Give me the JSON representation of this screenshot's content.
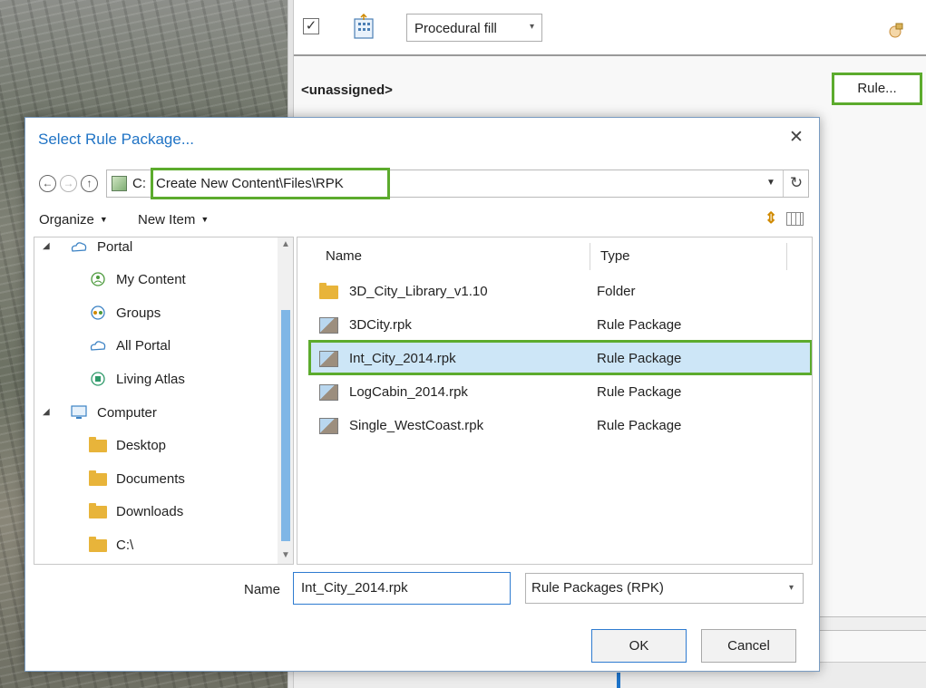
{
  "properties_pane": {
    "visible_checkbox": "✓",
    "fill_type": "Procedural fill",
    "rule_value": "<unassigned>",
    "rule_button": "Rule..."
  },
  "dialog": {
    "title": "Select Rule Package...",
    "close_glyph": "✕",
    "address": {
      "drive": "C:",
      "path": "Create New Content\\Files\\RPK"
    },
    "toolbar": {
      "organize": "Organize",
      "new_item": "New Item"
    },
    "tree": [
      {
        "label": "Portal",
        "icon": "portal-cloud-icon",
        "expander": "expanded"
      },
      {
        "label": "My Content",
        "icon": "my-content-icon"
      },
      {
        "label": "Groups",
        "icon": "groups-icon"
      },
      {
        "label": "All Portal",
        "icon": "cloud-icon"
      },
      {
        "label": "Living Atlas",
        "icon": "living-atlas-icon"
      },
      {
        "label": "Computer",
        "icon": "computer-icon",
        "expander": "expanded"
      },
      {
        "label": "Desktop",
        "icon": "folder-icon"
      },
      {
        "label": "Documents",
        "icon": "folder-icon"
      },
      {
        "label": "Downloads",
        "icon": "folder-icon"
      },
      {
        "label": "C:\\",
        "icon": "folder-icon"
      }
    ],
    "columns": {
      "name": "Name",
      "type": "Type"
    },
    "files": [
      {
        "name": "3D_City_Library_v1.10",
        "type": "Folder",
        "icon": "folder-icon"
      },
      {
        "name": "3DCity.rpk",
        "type": "Rule Package",
        "icon": "rule-package-icon"
      },
      {
        "name": "Int_City_2014.rpk",
        "type": "Rule Package",
        "icon": "rule-package-icon",
        "selected": true
      },
      {
        "name": "LogCabin_2014.rpk",
        "type": "Rule Package",
        "icon": "rule-package-icon"
      },
      {
        "name": "Single_WestCoast.rpk",
        "type": "Rule Package",
        "icon": "rule-package-icon"
      }
    ],
    "name_label": "Name",
    "name_value": "Int_City_2014.rpk",
    "filter_value": "Rule Packages (RPK)",
    "ok_label": "OK",
    "cancel_label": "Cancel"
  },
  "highlight_color": "#5cab2d",
  "accent_color": "#1f73c5"
}
